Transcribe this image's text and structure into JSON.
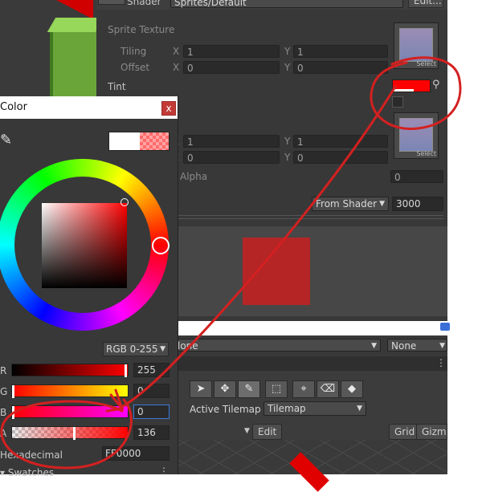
{
  "inspector": {
    "shader_label": "Shader",
    "shader_value": "Sprites/Default",
    "edit_button": "Edit...",
    "sprite_texture_label": "Sprite Texture",
    "tiling_label": "Tiling",
    "offset_label": "Offset",
    "x_label": "X",
    "y_label": "Y",
    "tiling_x": "1",
    "tiling_y": "1",
    "offset_x": "0",
    "offset_y": "0",
    "tiling2_x": "1",
    "tiling2_y": "1",
    "offset2_x": "0",
    "offset2_y": "0",
    "select_label": "Select",
    "tint_label": "Tint",
    "tint_color": "#ff0000",
    "alpha_label": "Alpha",
    "alpha_value": "0",
    "render_queue_mode": "From Shader",
    "render_queue_value": "3000"
  },
  "preview": {
    "quad_color": "#b52526"
  },
  "palette_row": {
    "left_value": "lone",
    "right_value": "None"
  },
  "tilemap_toolbar": {
    "tools": [
      {
        "name": "select-tool-button",
        "glyph": "➤"
      },
      {
        "name": "move-tool-button",
        "glyph": "✥"
      },
      {
        "name": "paint-brush-button",
        "glyph": "✎"
      },
      {
        "name": "box-fill-button",
        "glyph": "⬚"
      },
      {
        "name": "picker-tool-button",
        "glyph": "⌖"
      },
      {
        "name": "eraser-tool-button",
        "glyph": "⌫"
      },
      {
        "name": "fill-tool-button",
        "glyph": "◆"
      }
    ],
    "active_tilemap_label": "Active Tilemap",
    "active_tilemap_value": "Tilemap",
    "edit_label": "Edit",
    "grid_label": "Grid",
    "gizmos_label": "Gizmo"
  },
  "color_picker": {
    "title": "Color",
    "close_glyph": "x",
    "mode": "RGB 0-255",
    "r_label": "R",
    "r_value": "255",
    "g_label": "G",
    "g_value": "0",
    "b_label": "B",
    "b_value": "0",
    "a_label": "A",
    "a_value": "136",
    "hex_label": "Hexadecimal",
    "hex_value": "FF0000",
    "swatches_label": "Swatches",
    "current_color": "#ffffff",
    "new_color": "#ff0000"
  },
  "annotation_color": "#d42020"
}
